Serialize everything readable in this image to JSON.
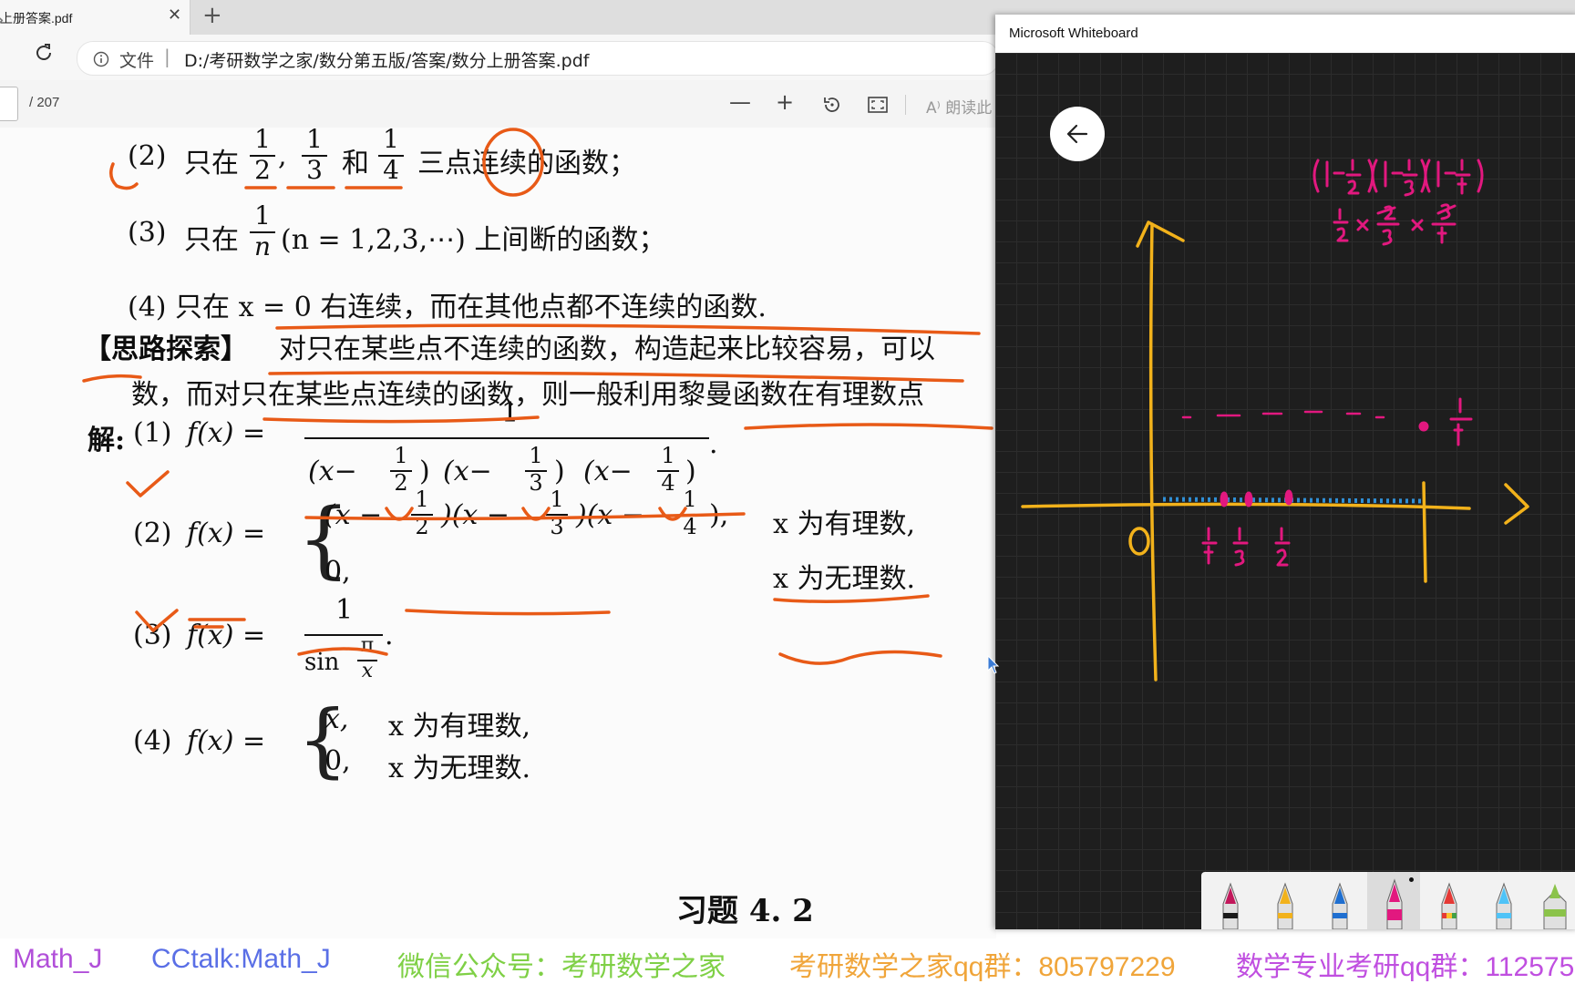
{
  "browser": {
    "tab_title": "上册答案.pdf",
    "close_glyph": "✕",
    "new_tab_glyph": "+",
    "url_scheme": "文件",
    "url_sep": "|",
    "url": "D:/考研数学之家/数分第五版/答案/数分上册答案.pdf"
  },
  "pdf_toolbar": {
    "page_total": "/ 207",
    "zoom_out": "—",
    "zoom_in": "+",
    "read_aloud": "A⁾ 朗读此"
  },
  "pdf": {
    "item2": {
      "num": "(2)",
      "lead": "只在",
      "f1n": "1",
      "f1d": "2",
      "f2n": "1",
      "f2d": "3",
      "and": "和",
      "f3n": "1",
      "f3d": "4",
      "tail": "三点连续的函数；"
    },
    "item3": {
      "num": "(3)",
      "lead": "只在",
      "fn": "1",
      "fd": "n",
      "tail": "(n = 1,2,3,⋯) 上间断的函数；"
    },
    "item4": {
      "text": "(4) 只在 x = 0 右连续，而在其他点都不连续的函数."
    },
    "idea_label": "【思路探索】",
    "idea_line1": "对只在某些点不连续的函数，构造起来比较容易，可以",
    "idea_line2": "数，而对只在某些点连续的函数，则一般利用黎曼函数在有理数点",
    "sol_label": "解:",
    "s1": {
      "num": "(1)",
      "lhs": "f(x) =",
      "numer": "1",
      "denom": "(x − 1/2)(x − 1/3)(x − 1/4)",
      "p1a": "(x−",
      "fa": "1",
      "fb": "2",
      "p1b": ")",
      "p2a": "(x−",
      "ga": "1",
      "gb": "3",
      "p2b": ")",
      "p3a": "(x−",
      "ha": "1",
      "hb": "4",
      "p3b": ")",
      "end": "."
    },
    "s2": {
      "num": "(2)",
      "lhs": "f(x) =",
      "brace": "{",
      "case1": "(x − ",
      "c1a": "1",
      "c1b": "2",
      "mid1": ")(x − ",
      "c2a": "1",
      "c2b": "3",
      "mid2": ")(x − ",
      "c3a": "1",
      "c3b": "4",
      "end1": "),",
      "cond1": "x 为有理数,",
      "case2": "0,",
      "cond2": "x 为无理数."
    },
    "s3": {
      "num": "(3)",
      "lhs": "f(x) =",
      "numer": "1",
      "denom_sin": "sin",
      "pi": "π",
      "x": "x",
      "end": "."
    },
    "s4": {
      "num": "(4)",
      "lhs": "f(x) =",
      "brace": "{",
      "case1": "x,",
      "cond1": "x 为有理数,",
      "case2": "0,",
      "cond2": "x 为无理数."
    },
    "section": "习题 4. 2"
  },
  "whiteboard": {
    "title": "Microsoft Whiteboard",
    "back_icon": "arrow-left-icon",
    "ink_colors": {
      "axes": "#f2b21b",
      "magenta": "#e2187f",
      "orange": "#e85a17",
      "blue": "#2f8fd6"
    },
    "notes": {
      "origin": "0",
      "tick_one": "1",
      "x_labels": [
        "1/4",
        "1/3",
        "1/2"
      ],
      "point_label": "1/4",
      "product": "(1 - 1/2)(1 - 1/3)(1 - 1/4)",
      "product_line2": "1/2 × 2/3 × 3/4"
    },
    "pens": [
      "black",
      "yellow",
      "blue",
      "magenta",
      "rainbow",
      "light-blue",
      "highlighter"
    ]
  },
  "watermark": {
    "items": [
      {
        "text": "Math_J",
        "color": "#b14fd9"
      },
      {
        "text": "CCtalk:Math_J",
        "color": "#5a6fe6"
      },
      {
        "text": "微信公众号：考研数学之家",
        "color": "#7fd046"
      },
      {
        "text": "考研数学之家qq群：805797229",
        "color": "#f0a53a"
      },
      {
        "text": "数学专业考研qq群：112575",
        "color": "#c04fe0"
      }
    ]
  }
}
